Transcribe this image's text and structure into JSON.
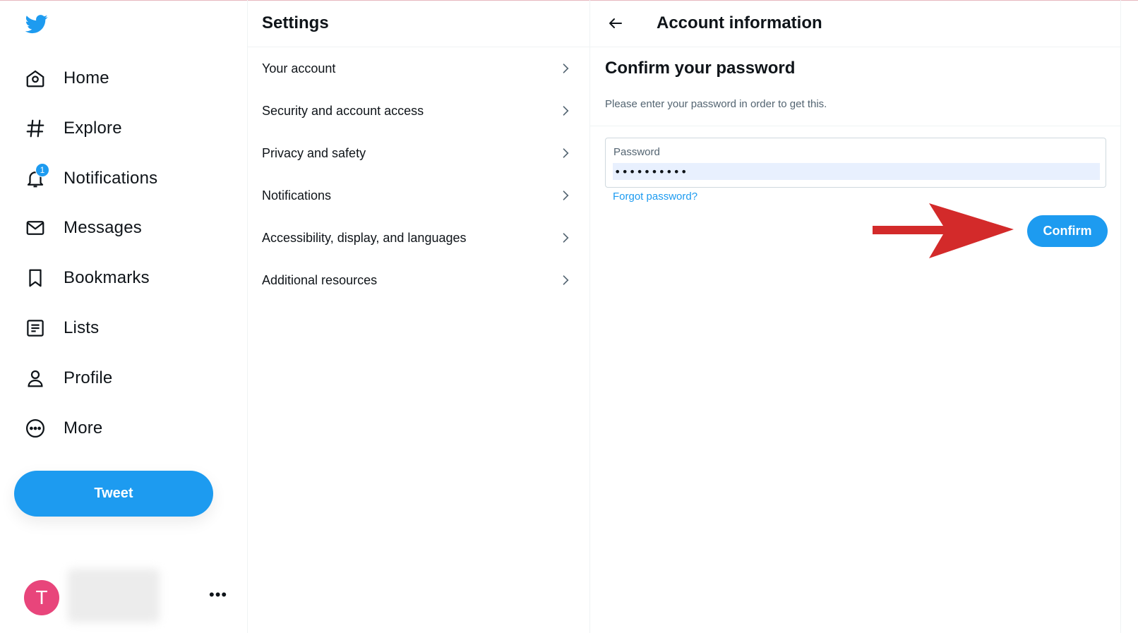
{
  "nav": {
    "items": [
      {
        "label": "Home",
        "icon": "home-icon"
      },
      {
        "label": "Explore",
        "icon": "hashtag-icon"
      },
      {
        "label": "Notifications",
        "icon": "bell-icon",
        "badge": "1"
      },
      {
        "label": "Messages",
        "icon": "envelope-icon"
      },
      {
        "label": "Bookmarks",
        "icon": "bookmark-icon"
      },
      {
        "label": "Lists",
        "icon": "list-icon"
      },
      {
        "label": "Profile",
        "icon": "person-icon"
      },
      {
        "label": "More",
        "icon": "more-circle-icon"
      }
    ],
    "tweet_label": "Tweet",
    "account": {
      "avatar_letter": "T",
      "more": "•••"
    }
  },
  "settings": {
    "title": "Settings",
    "items": [
      {
        "label": "Your account"
      },
      {
        "label": "Security and account access"
      },
      {
        "label": "Privacy and safety"
      },
      {
        "label": "Notifications"
      },
      {
        "label": "Accessibility, display, and languages"
      },
      {
        "label": "Additional resources"
      }
    ]
  },
  "panel": {
    "title": "Account information",
    "confirm_title": "Confirm your password",
    "description": "Please enter your password in order to get this.",
    "password_label": "Password",
    "password_value": "••••••••••",
    "forgot_label": "Forgot password?",
    "confirm_label": "Confirm"
  },
  "colors": {
    "accent": "#1d9bf0",
    "annotation_arrow": "#d32a2a",
    "avatar": "#e8457b"
  }
}
